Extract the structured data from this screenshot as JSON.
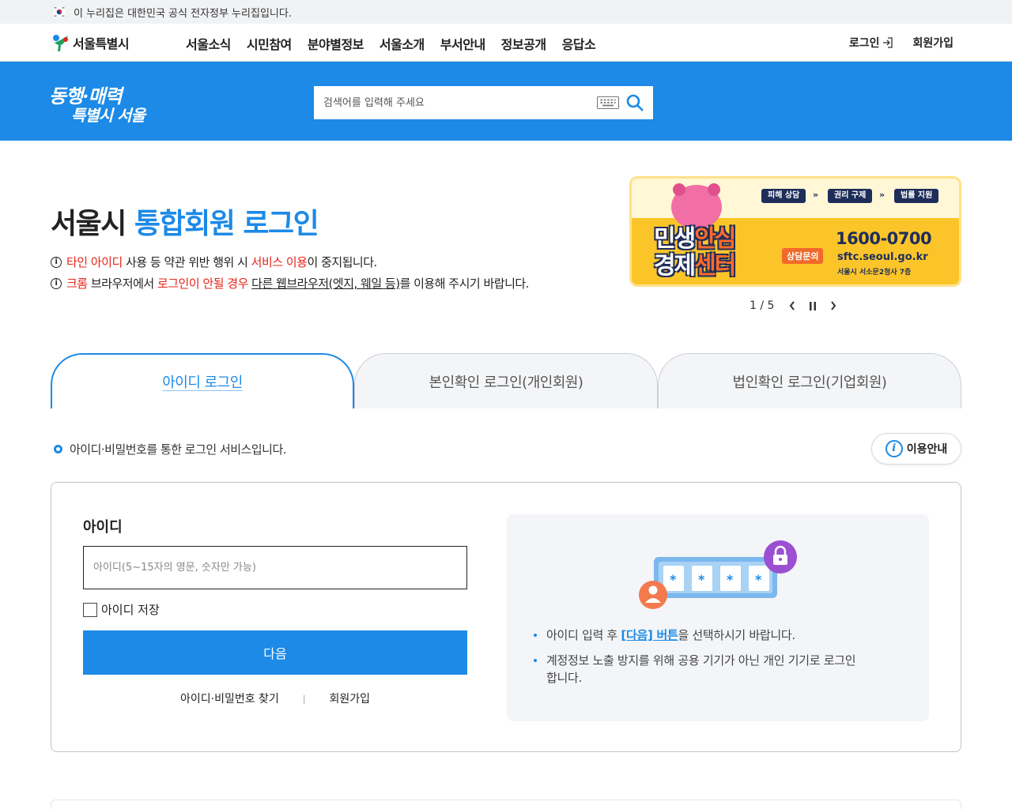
{
  "gov_bar": {
    "text": "이 누리집은 대한민국 공식 전자정부 누리집입니다."
  },
  "header": {
    "logo_text": "서울특별시",
    "menu": [
      "서울소식",
      "시민참여",
      "분야별정보",
      "서울소개",
      "부서안내",
      "정보공개",
      "응답소"
    ],
    "login_label": "로그인",
    "signup_label": "회원가입"
  },
  "band": {
    "slogan_line1": "동행·매력",
    "slogan_line2": "특별시 서울",
    "search_placeholder": "검색어를 입력해 주세요"
  },
  "title": {
    "prefix": "서울시 ",
    "highlight": "통합회원 로그인"
  },
  "notices": [
    {
      "parts": [
        {
          "t": "타인 아이디",
          "red": true
        },
        {
          "t": " 사용 등 약관 위반 행위 시 "
        },
        {
          "t": "서비스 이용",
          "red": true
        },
        {
          "t": "이 중지됩니다."
        }
      ]
    },
    {
      "parts": [
        {
          "t": "크롬",
          "red": true
        },
        {
          "t": " 브라우저에서 "
        },
        {
          "t": "로그인이 안될 경우",
          "red": true
        },
        {
          "t": " "
        },
        {
          "t": "다른 웹브라우저(엣지, 웨일 등)",
          "u": true
        },
        {
          "t": "를 이용해 주시기 바랍니다."
        }
      ]
    }
  ],
  "banner": {
    "tags": [
      "피해 상담",
      "권리 구제",
      "법률 지원"
    ],
    "title_line1_a": "민생",
    "title_line1_b": "안심",
    "title_line2_a": "경제",
    "title_line2_b": "센터",
    "consult_label": "상담문의",
    "phone": "1600-0700",
    "url": "sftc.seoul.go.kr",
    "address": "서울시 서소문2청사 7층"
  },
  "pager": {
    "current": 1,
    "total": 5,
    "text": "1 / 5"
  },
  "tabs": [
    {
      "label": "아이디 로그인",
      "active": true
    },
    {
      "label": "본인확인 로그인(개인회원)",
      "active": false
    },
    {
      "label": "법인확인 로그인(기업회원)",
      "active": false
    }
  ],
  "description": "아이디·비밀번호를 통한 로그인 서비스입니다.",
  "guide_button": {
    "icon_text": "i",
    "label": "이용안내"
  },
  "form": {
    "id_label": "아이디",
    "id_placeholder": "아이디(5~15자의 영문, 숫자만 가능)",
    "id_value": "",
    "save_label": "아이디 저장",
    "save_checked": false,
    "next_label": "다음",
    "find_label": "아이디·비밀번호 찾기",
    "separator": "|",
    "signup_label": "회원가입"
  },
  "info": {
    "item1_before": "아이디 입력 후 ",
    "item1_highlight": "[다음] 버튼",
    "item1_after": "을 선택하시기 바랍니다.",
    "item2": "계정정보 노출 방지를 위해 공용 기기가 아닌 개인 기기로 로그인합니다.",
    "password_mask": "*"
  },
  "colors": {
    "primary": "#1c8ae6",
    "alert": "#e8231a",
    "banner_yellow": "#fbc52a",
    "banner_navy": "#1e2d5a"
  },
  "icons": [
    "korea-flag-icon",
    "seoul-logo-icon",
    "login-arrow-icon",
    "keyboard-icon",
    "search-icon",
    "info-icon",
    "prev-icon",
    "pause-icon",
    "next-icon",
    "user-icon",
    "lock-icon"
  ]
}
